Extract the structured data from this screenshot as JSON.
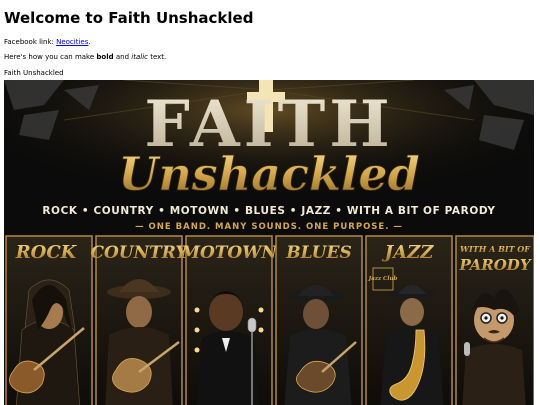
{
  "page": {
    "title": "Welcome to Faith Unshackled",
    "facebook_prefix": "Facebook link: ",
    "facebook_link_text": "Neocities",
    "facebook_suffix": ".",
    "format_prefix": "Here's how you can make ",
    "format_bold": "bold",
    "format_middle": " and ",
    "format_italic": "italic",
    "format_suffix": " text.",
    "band_name": "Faith Unshackled"
  },
  "banner": {
    "title_top": "FAITH",
    "title_script": "Unshackled",
    "genres_line": "ROCK • COUNTRY • MOTOWN • BLUES • JAZZ • WITH A BIT OF PARODY",
    "tagline": "— ONE BAND. MANY SOUNDS. ONE PURPOSE. —",
    "panels": [
      "ROCK",
      "COUNTRY",
      "MOTOWN",
      "BLUES",
      "JAZZ",
      "WITH A BIT OF",
      "PARODY"
    ],
    "jazz_sign": "Jazz Club",
    "colors": {
      "gold": "#d4a84a",
      "gold_light": "#f0cf7a",
      "cream": "#e8dcc0",
      "background": "#0b0b0b"
    }
  }
}
